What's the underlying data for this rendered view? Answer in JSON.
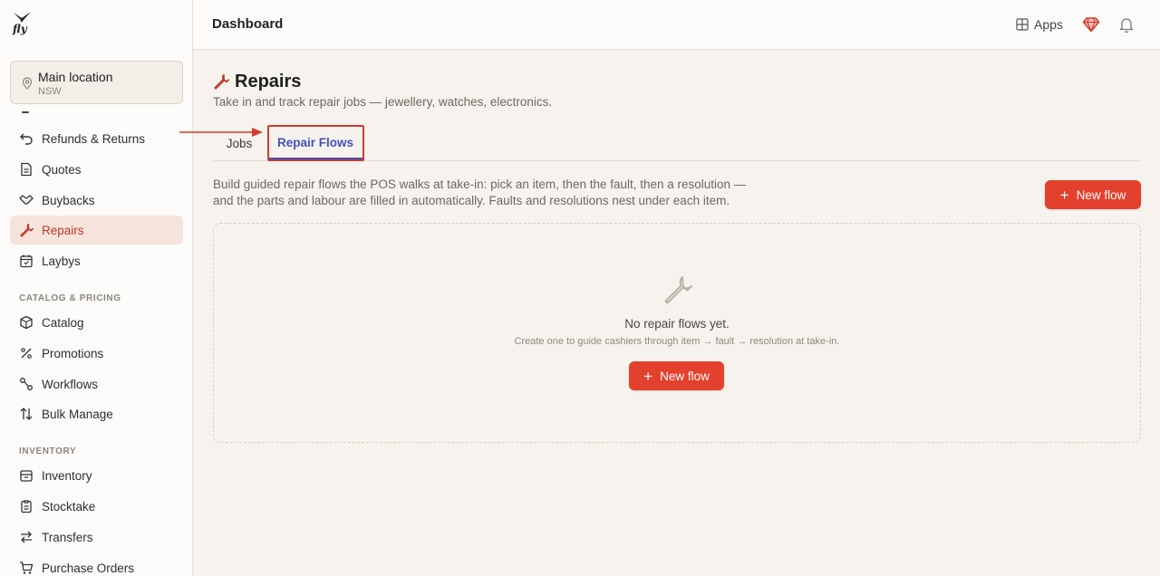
{
  "app": {
    "logo_text": "fly"
  },
  "location": {
    "name": "Main location",
    "region": "NSW"
  },
  "sidebar": {
    "items_top": [
      {
        "label": "Refunds & Returns",
        "icon": "undo-icon"
      },
      {
        "label": "Quotes",
        "icon": "document-icon"
      },
      {
        "label": "Buybacks",
        "icon": "handshake-icon"
      },
      {
        "label": "Repairs",
        "icon": "wrench-icon",
        "active": true
      },
      {
        "label": "Laybys",
        "icon": "calendar-icon"
      }
    ],
    "section_catalog": "CATALOG & PRICING",
    "items_catalog": [
      {
        "label": "Catalog",
        "icon": "box-icon"
      },
      {
        "label": "Promotions",
        "icon": "percent-icon"
      },
      {
        "label": "Workflows",
        "icon": "workflow-icon"
      },
      {
        "label": "Bulk Manage",
        "icon": "sort-arrows-icon"
      }
    ],
    "section_inventory": "INVENTORY",
    "items_inventory": [
      {
        "label": "Inventory",
        "icon": "inventory-icon"
      },
      {
        "label": "Stocktake",
        "icon": "clipboard-icon"
      },
      {
        "label": "Transfers",
        "icon": "transfer-icon"
      },
      {
        "label": "Purchase Orders",
        "icon": "cart-icon"
      }
    ]
  },
  "topbar": {
    "title": "Dashboard",
    "apps_label": "Apps"
  },
  "page": {
    "title": "Repairs",
    "subtitle": "Take in and track repair jobs — jewellery, watches, electronics.",
    "tabs": [
      {
        "label": "Jobs"
      },
      {
        "label": "Repair Flows",
        "active": true
      }
    ],
    "description": "Build guided repair flows the POS walks at take-in: pick an item, then the fault, then a resolution — and the parts and labour are filled in automatically. Faults and resolutions nest under each item.",
    "new_flow_label": "New flow",
    "empty": {
      "title": "No repair flows yet.",
      "subtitle": "Create one to guide cashiers through item → fault → resolution at take-in.",
      "button_label": "New flow"
    }
  },
  "colors": {
    "accent": "#e3412d",
    "tab_active": "#4350b8",
    "highlight": "#d53b2c"
  }
}
